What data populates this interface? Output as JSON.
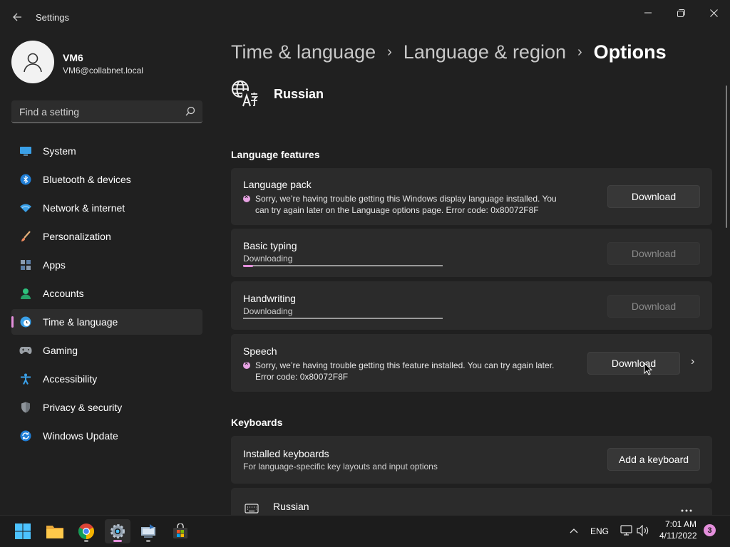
{
  "window": {
    "app_title": "Settings",
    "controls": [
      "minimize",
      "restore",
      "close"
    ]
  },
  "profile": {
    "name": "VM6",
    "email": "VM6@collabnet.local"
  },
  "search": {
    "placeholder": "Find a setting"
  },
  "sidebar": {
    "items": [
      {
        "label": "System",
        "icon": "system-icon"
      },
      {
        "label": "Bluetooth & devices",
        "icon": "bluetooth-icon"
      },
      {
        "label": "Network & internet",
        "icon": "wifi-icon"
      },
      {
        "label": "Personalization",
        "icon": "brush-icon"
      },
      {
        "label": "Apps",
        "icon": "apps-icon"
      },
      {
        "label": "Accounts",
        "icon": "accounts-icon"
      },
      {
        "label": "Time & language",
        "icon": "globe-clock-icon",
        "active": true
      },
      {
        "label": "Gaming",
        "icon": "gamepad-icon"
      },
      {
        "label": "Accessibility",
        "icon": "accessibility-icon"
      },
      {
        "label": "Privacy & security",
        "icon": "shield-icon"
      },
      {
        "label": "Windows Update",
        "icon": "update-icon"
      }
    ]
  },
  "breadcrumb": {
    "parts": [
      "Time & language",
      "Language & region"
    ],
    "current": "Options"
  },
  "language": {
    "name": "Russian"
  },
  "sections": {
    "features": "Language features",
    "keyboards": "Keyboards"
  },
  "features": {
    "language_pack": {
      "title": "Language pack",
      "error": "Sorry, we’re having trouble getting this Windows display language installed. You can try again later on the Language options page. Error code: 0x80072F8F",
      "button": "Download"
    },
    "basic_typing": {
      "title": "Basic typing",
      "status": "Downloading",
      "progress": 0.05,
      "button": "Download"
    },
    "handwriting": {
      "title": "Handwriting",
      "status": "Downloading",
      "progress": 0.0,
      "button": "Download"
    },
    "speech": {
      "title": "Speech",
      "error": "Sorry, we’re having trouble getting this feature installed. You can try again later. Error code: 0x80072F8F",
      "button": "Download"
    }
  },
  "keyboards": {
    "installed": {
      "title": "Installed keyboards",
      "subtitle": "For language-specific key layouts and input options",
      "button": "Add a keyboard"
    },
    "list": [
      {
        "name": "Russian"
      }
    ]
  },
  "taskbar": {
    "apps": [
      "start-icon",
      "file-explorer-icon",
      "chrome-icon",
      "settings-icon",
      "network-app-icon",
      "store-icon"
    ],
    "tray": {
      "language": "ENG",
      "time": "7:01 AM",
      "date": "4/11/2022",
      "notifications": "3"
    }
  },
  "colors": {
    "accent": "#e48fdc",
    "background": "#202020",
    "card": "#2b2b2b",
    "error_icon": "#e8a3e4"
  }
}
